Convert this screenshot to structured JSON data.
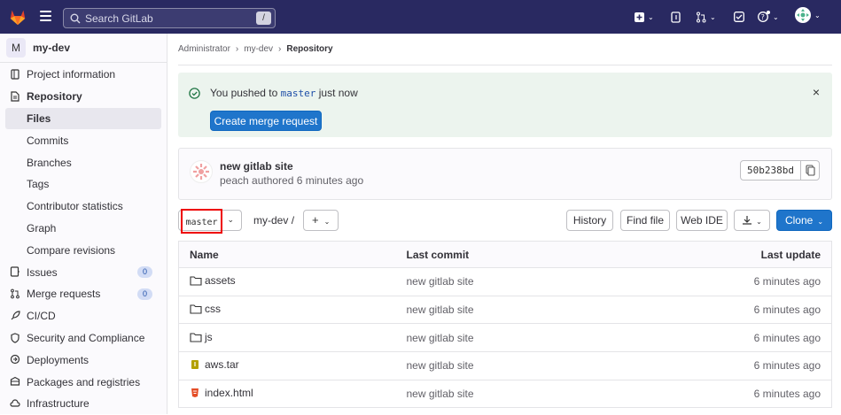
{
  "topbar": {
    "search_placeholder": "Search GitLab",
    "search_shortcut": "/",
    "logo_icon": "gitlab-tanuki-icon",
    "icons": [
      "plus-icon",
      "issues-icon",
      "merge-request-icon",
      "todo-icon",
      "help-icon",
      "user-avatar-icon"
    ]
  },
  "sidebar": {
    "project_initial": "M",
    "project_name": "my-dev",
    "items": [
      {
        "label": "Project information",
        "icon": "info-icon"
      },
      {
        "label": "Repository",
        "icon": "doc-icon"
      },
      {
        "label": "Files"
      },
      {
        "label": "Commits"
      },
      {
        "label": "Branches"
      },
      {
        "label": "Tags"
      },
      {
        "label": "Contributor statistics"
      },
      {
        "label": "Graph"
      },
      {
        "label": "Compare revisions"
      },
      {
        "label": "Issues",
        "icon": "issues-icon",
        "count": "0"
      },
      {
        "label": "Merge requests",
        "icon": "merge-request-icon",
        "count": "0"
      },
      {
        "label": "CI/CD",
        "icon": "rocket-icon"
      },
      {
        "label": "Security and Compliance",
        "icon": "shield-icon"
      },
      {
        "label": "Deployments",
        "icon": "deploy-icon"
      },
      {
        "label": "Packages and registries",
        "icon": "package-icon"
      },
      {
        "label": "Infrastructure",
        "icon": "cloud-icon"
      }
    ]
  },
  "breadcrumb": {
    "items": [
      "Administrator",
      "my-dev",
      "Repository"
    ],
    "sep": "›"
  },
  "alert": {
    "prefix": "You pushed to",
    "branch": "master",
    "suffix": "just now",
    "button": "Create merge request",
    "close": "×"
  },
  "commit": {
    "title": "new gitlab site",
    "meta": "peach authored 6 minutes ago",
    "sha": "50b238bd"
  },
  "toolbar": {
    "branch": "master",
    "path": "my-dev",
    "path_sep": "/",
    "plus": "+",
    "history": "History",
    "find_file": "Find file",
    "web_ide": "Web IDE",
    "clone": "Clone"
  },
  "table": {
    "headers": [
      "Name",
      "Last commit",
      "Last update"
    ],
    "rows": [
      {
        "name": "assets",
        "type": "folder",
        "commit": "new gitlab site",
        "updated": "6 minutes ago"
      },
      {
        "name": "css",
        "type": "folder",
        "commit": "new gitlab site",
        "updated": "6 minutes ago"
      },
      {
        "name": "js",
        "type": "folder",
        "commit": "new gitlab site",
        "updated": "6 minutes ago"
      },
      {
        "name": "aws.tar",
        "type": "archive",
        "commit": "new gitlab site",
        "updated": "6 minutes ago"
      },
      {
        "name": "index.html",
        "type": "html",
        "commit": "new gitlab site",
        "updated": "6 minutes ago"
      }
    ]
  },
  "colors": {
    "topbar": "#292961",
    "primary": "#1f75cb",
    "alert_bg": "#ecf4ee",
    "highlight": "#ee0000"
  }
}
